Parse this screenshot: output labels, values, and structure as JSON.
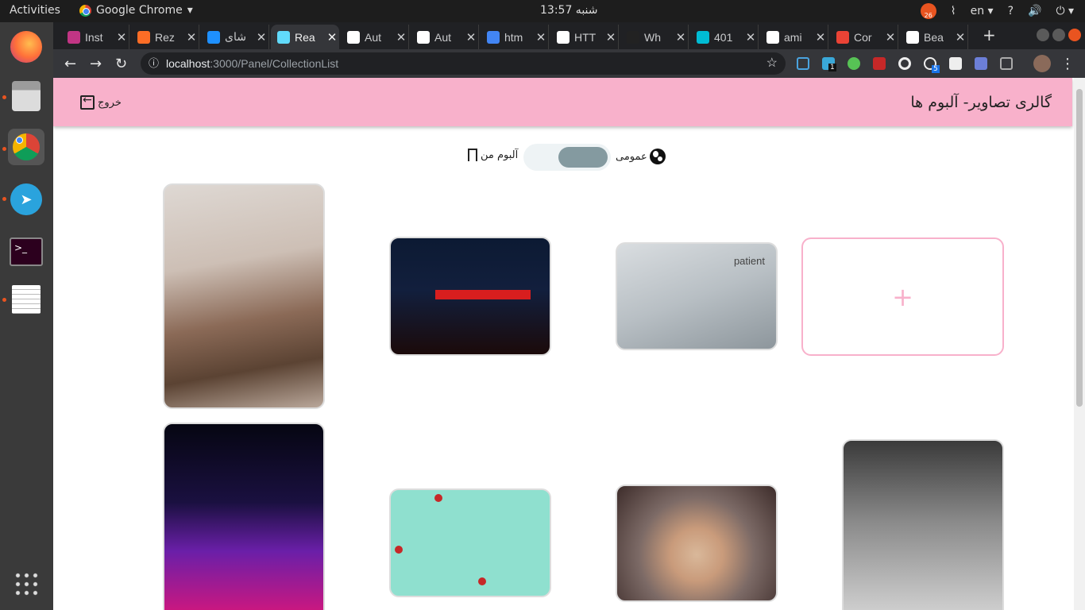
{
  "system": {
    "activities": "Activities",
    "app": "Google Chrome",
    "clock": "شنبه 13:57",
    "lang": "en",
    "badge": "26"
  },
  "tabs": [
    {
      "label": "Inst",
      "color": "#c13584"
    },
    {
      "label": "Rez",
      "color": "#fc6d26"
    },
    {
      "label": "شای",
      "color": "#1e90ff"
    },
    {
      "label": "Rea",
      "color": "#61dafb",
      "active": true
    },
    {
      "label": "Aut",
      "color": "#ffffff"
    },
    {
      "label": "Aut",
      "color": "#ffffff"
    },
    {
      "label": "htm",
      "color": "#4285f4"
    },
    {
      "label": "HTT",
      "color": "#ffffff"
    },
    {
      "label": "Wh",
      "color": "#222222"
    },
    {
      "label": "401",
      "color": "#00bcd4"
    },
    {
      "label": "ami",
      "color": "#ffffff"
    },
    {
      "label": "Cor",
      "color": "#ea4335"
    },
    {
      "label": "Bea",
      "color": "#ffffff"
    }
  ],
  "omni": {
    "host": "localhost",
    "path": ":3000/Panel/CollectionList"
  },
  "ext_badges": {
    "a": "1",
    "b": "5"
  },
  "header": {
    "title": "گالری تصاویر- آلبوم ها",
    "logout": "خروج"
  },
  "toggle": {
    "mine": "آلبوم من",
    "public": "عمومی",
    "state": "public"
  },
  "gallery": {
    "add": "+",
    "caption": "patient"
  },
  "colors": {
    "header": "#f8b1cb",
    "knob": "#849aa0",
    "add_border": "#f8b1cb"
  }
}
